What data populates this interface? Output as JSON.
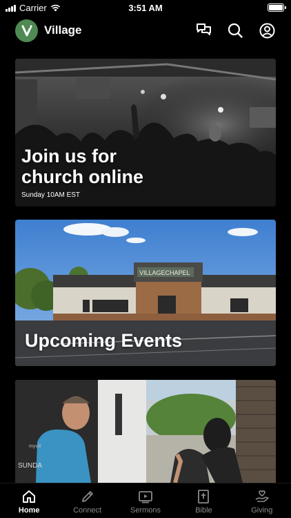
{
  "status_bar": {
    "carrier": "Carrier",
    "time": "3:51 AM"
  },
  "header": {
    "app_name": "Village",
    "icons": [
      "chat-bubbles-icon",
      "search-icon",
      "account-icon"
    ]
  },
  "cards": [
    {
      "title_line1": "Join us for",
      "title_line2": "church online",
      "subtitle": "Sunday 10AM EST"
    },
    {
      "title": "Upcoming Events",
      "sign_text": "VILLAGECHAPEL"
    },
    {
      "title": "",
      "wall_text": "myvill",
      "wall_text2": "SUNDA"
    }
  ],
  "tabs": [
    {
      "label": "Home",
      "icon": "home-icon",
      "active": true
    },
    {
      "label": "Connect",
      "icon": "pencil-icon",
      "active": false
    },
    {
      "label": "Sermons",
      "icon": "video-player-icon",
      "active": false
    },
    {
      "label": "Bible",
      "icon": "bible-icon",
      "active": false
    },
    {
      "label": "Giving",
      "icon": "giving-hand-icon",
      "active": false
    }
  ],
  "colors": {
    "background": "#000000",
    "logo": "#4e8a52",
    "tab_inactive": "#8a8a8a",
    "tab_active": "#ffffff"
  }
}
